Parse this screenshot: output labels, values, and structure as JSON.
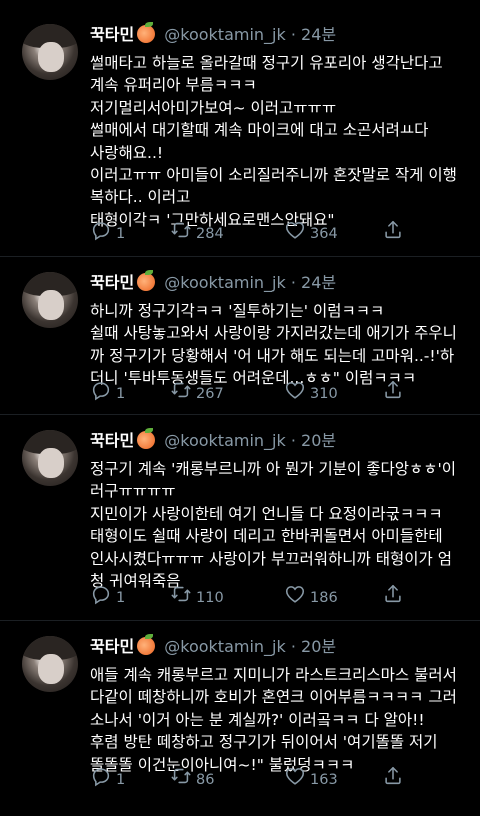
{
  "tweets": [
    {
      "name": "꾹타민",
      "handle": "@kooktamin_jk",
      "dot": "·",
      "time": "24분",
      "text": "썰매타고 하늘로 올라갈때 정구기 유포리아 생각난다고\n계속 유퍼리아 부름ㅋㅋㅋ\n저기멀리서아미가보여~ 이러고ㅠㅠㅠ\n썰매에서 대기할때 계속 마이크에 대고 소곤서려ㅛ다\n사랑해요..!\n이러고ㅠㅠ 아미들이 소리질러주니까 혼잣말로 작게 이행\n복하다.. 이러고\n태형이각ㅋ '그만하세요로맨스안돼요\"",
      "replies": "1",
      "retweets": "284",
      "likes": "364"
    },
    {
      "name": "꾹타민",
      "handle": "@kooktamin_jk",
      "dot": "·",
      "time": "24분",
      "text": "하니까 정구기각ㅋㅋ '질투하기는' 이럼ㅋㅋㅋ\n쉴때 사탕놓고와서 사랑이랑 가지러갔는데 애기가 주우니\n까 정구기가 당황해서 '어 내가 해도 되는데 고마워..-!'하\n더니 '투바투동생들도 어려운데...ㅎㅎ\" 이럼ㅋㅋㅋ",
      "replies": "1",
      "retweets": "267",
      "likes": "310"
    },
    {
      "name": "꾹타민",
      "handle": "@kooktamin_jk",
      "dot": "·",
      "time": "20분",
      "text": "정구기 계속 '캐롱부르니까 아 뭔가 기분이 좋다앙ㅎㅎ'이\n러구ㅠㅠㅠㅠ\n지민이가 사랑이한테 여기 언니들 다 요정이라굯ㅋㅋㅋ\n태형이도 쉴때 사랑이 데리고 한바퀴돌면서 아미들한테\n인사시켰다ㅠㅠㅠ 사랑이가 부끄러워하니까 태형이가 엄\n청 귀여워죽음",
      "replies": "1",
      "retweets": "110",
      "likes": "186"
    },
    {
      "name": "꾹타민",
      "handle": "@kooktamin_jk",
      "dot": "·",
      "time": "20분",
      "text": "애들 계속 캐롱부르고 지미니가 라스트크리스마스 불러서\n다같이 떼창하니까 호비가 혼연크 이어부름ㅋㅋㅋㅋ 그러\n소나서 '이거 아는 분 계실까?' 이러곸ㅋㅋ 다 알아!!\n후렴 방탄 떼창하고 정구기가 뒤이어서 '여기똘똘 저기\n똘똘똘 이건눈이아니여~!\" 불렀덩ㅋㅋㅋ",
      "replies": "1",
      "retweets": "86",
      "likes": "163"
    }
  ],
  "icons": {
    "reply": "reply-icon",
    "retweet": "retweet-icon",
    "like": "heart-icon",
    "share": "share-icon",
    "badge": "peach-emoji-icon"
  }
}
